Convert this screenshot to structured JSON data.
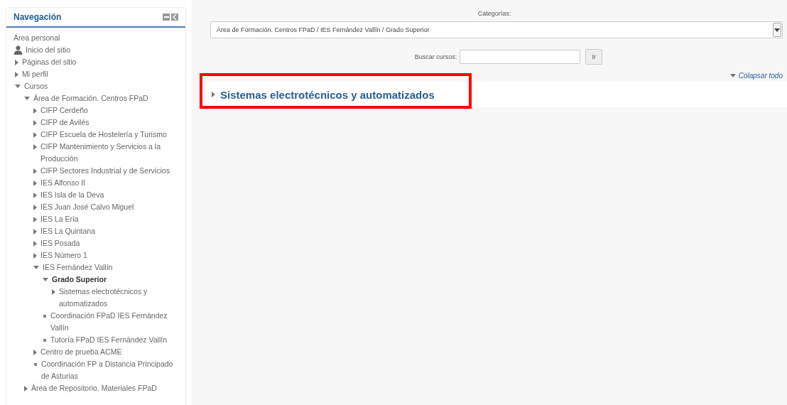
{
  "navigation": {
    "title": "Navegación",
    "items": [
      {
        "kind": "plain",
        "label": "Área personal",
        "selected": false
      },
      {
        "kind": "home",
        "label": "Inicio del sitio",
        "selected": false
      },
      {
        "kind": "branch",
        "label": "Páginas del sitio",
        "expanded": false,
        "selected": false
      },
      {
        "kind": "branch",
        "label": "Mi perfil",
        "expanded": false,
        "selected": false
      },
      {
        "kind": "branch",
        "label": "Cursos",
        "expanded": true,
        "selected": false,
        "children": [
          {
            "kind": "branch",
            "label": "Área de Formación. Centros FPaD",
            "expanded": true,
            "selected": false,
            "children": [
              {
                "kind": "branch",
                "label": "CIFP Cerdeño",
                "expanded": false,
                "selected": false
              },
              {
                "kind": "branch",
                "label": "CIFP de Avilés",
                "expanded": false,
                "selected": false
              },
              {
                "kind": "branch",
                "label": "CIFP Escuela de Hostelería y Turismo",
                "expanded": false,
                "selected": false
              },
              {
                "kind": "branch",
                "label": "CIFP Mantenimiento y Servicios a la Producción",
                "expanded": false,
                "selected": false
              },
              {
                "kind": "branch",
                "label": "CIFP Sectores Industrial y de Servicios",
                "expanded": false,
                "selected": false
              },
              {
                "kind": "branch",
                "label": "IES Alfonso II",
                "expanded": false,
                "selected": false
              },
              {
                "kind": "branch",
                "label": "IES Isla de la Deva",
                "expanded": false,
                "selected": false
              },
              {
                "kind": "branch",
                "label": "IES Juan José Calvo Miguel",
                "expanded": false,
                "selected": false
              },
              {
                "kind": "branch",
                "label": "IES La Ería",
                "expanded": false,
                "selected": false
              },
              {
                "kind": "branch",
                "label": "IES La Quintana",
                "expanded": false,
                "selected": false
              },
              {
                "kind": "branch",
                "label": "IES Posada",
                "expanded": false,
                "selected": false
              },
              {
                "kind": "branch",
                "label": "IES Número 1",
                "expanded": false,
                "selected": false
              },
              {
                "kind": "branch",
                "label": "IES Fernández Vallín",
                "expanded": true,
                "selected": false,
                "children": [
                  {
                    "kind": "branch",
                    "label": "Grado Superior",
                    "expanded": true,
                    "selected": true,
                    "children": [
                      {
                        "kind": "branch",
                        "label": "Sistemas electrotécnicos y automatizados",
                        "expanded": false,
                        "selected": false
                      }
                    ]
                  },
                  {
                    "kind": "bullet",
                    "label": "Coordinación FPaD IES Fernández Vallín",
                    "selected": false
                  },
                  {
                    "kind": "bullet",
                    "label": "Tutoría FPaD IES Fernández Vallín",
                    "selected": false
                  }
                ]
              },
              {
                "kind": "branch",
                "label": "Centro de prueba ACME",
                "expanded": false,
                "selected": false
              },
              {
                "kind": "bullet",
                "label": "Coordinación FP a Distancia Principado de Asturias",
                "selected": false
              }
            ]
          },
          {
            "kind": "branch",
            "label": "Área de Repositorio. Materiales FPaD",
            "expanded": false,
            "selected": false
          }
        ]
      }
    ]
  },
  "main": {
    "category_label": "Categorías:",
    "category_value": "Área de Formación. Centros FPaD / IES Fernández Vallín / Grado Superior",
    "search_label": "Buscar cursos:",
    "search_button": "Ir",
    "collapse_all": "Colapsar todo",
    "courses": [
      {
        "title": "Sistemas electrotécnicos y automatizados",
        "expanded": false,
        "highlighted": true
      }
    ]
  }
}
